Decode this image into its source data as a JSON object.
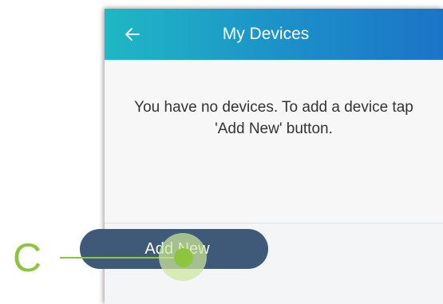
{
  "header": {
    "back_icon": "arrow-left-icon",
    "title": "My Devices"
  },
  "main": {
    "empty_message": "You have no devices. To add a device tap 'Add New' button."
  },
  "footer": {
    "add_button_label": "Add New"
  },
  "annotation": {
    "callout_letter": "C",
    "color": "#8cc63f"
  },
  "colors": {
    "header_gradient_start": "#1fb8c4",
    "header_gradient_end": "#1b74c8",
    "button_bg": "#3f5a78"
  }
}
